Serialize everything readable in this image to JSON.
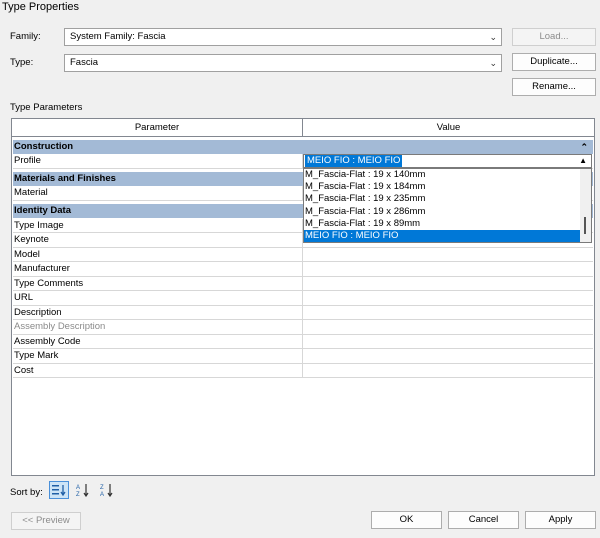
{
  "window": {
    "title": "Type Properties"
  },
  "family": {
    "label": "Family:",
    "value": "System Family: Fascia",
    "load_label": "Load..."
  },
  "type": {
    "label": "Type:",
    "value": "Fascia",
    "duplicate_label": "Duplicate...",
    "rename_label": "Rename..."
  },
  "type_parameters": {
    "label": "Type Parameters",
    "headers": {
      "parameter": "Parameter",
      "value": "Value"
    },
    "groups": {
      "construction": "Construction",
      "materials": "Materials and Finishes",
      "identity": "Identity Data"
    },
    "rows": {
      "profile": "Profile",
      "material": "Material",
      "type_image": "Type Image",
      "keynote": "Keynote",
      "model": "Model",
      "manufacturer": "Manufacturer",
      "type_comments": "Type Comments",
      "url": "URL",
      "description": "Description",
      "assembly_description": "Assembly Description",
      "assembly_code": "Assembly Code",
      "type_mark": "Type Mark",
      "cost": "Cost"
    },
    "profile_dropdown": {
      "selected": "MEIO FIO : MEIO FIO",
      "options": [
        "M_Fascia-Flat : 19 x 140mm",
        "M_Fascia-Flat : 19 x 184mm",
        "M_Fascia-Flat : 19 x 235mm",
        "M_Fascia-Flat : 19 x 286mm",
        "M_Fascia-Flat : 19 x 89mm",
        "MEIO FIO : MEIO FIO"
      ]
    }
  },
  "sort": {
    "label": "Sort by:"
  },
  "footer": {
    "preview_label": "<< Preview",
    "ok_label": "OK",
    "cancel_label": "Cancel",
    "apply_label": "Apply"
  },
  "colors": {
    "group_header": "#a3bad6",
    "selection": "#0078d7"
  }
}
